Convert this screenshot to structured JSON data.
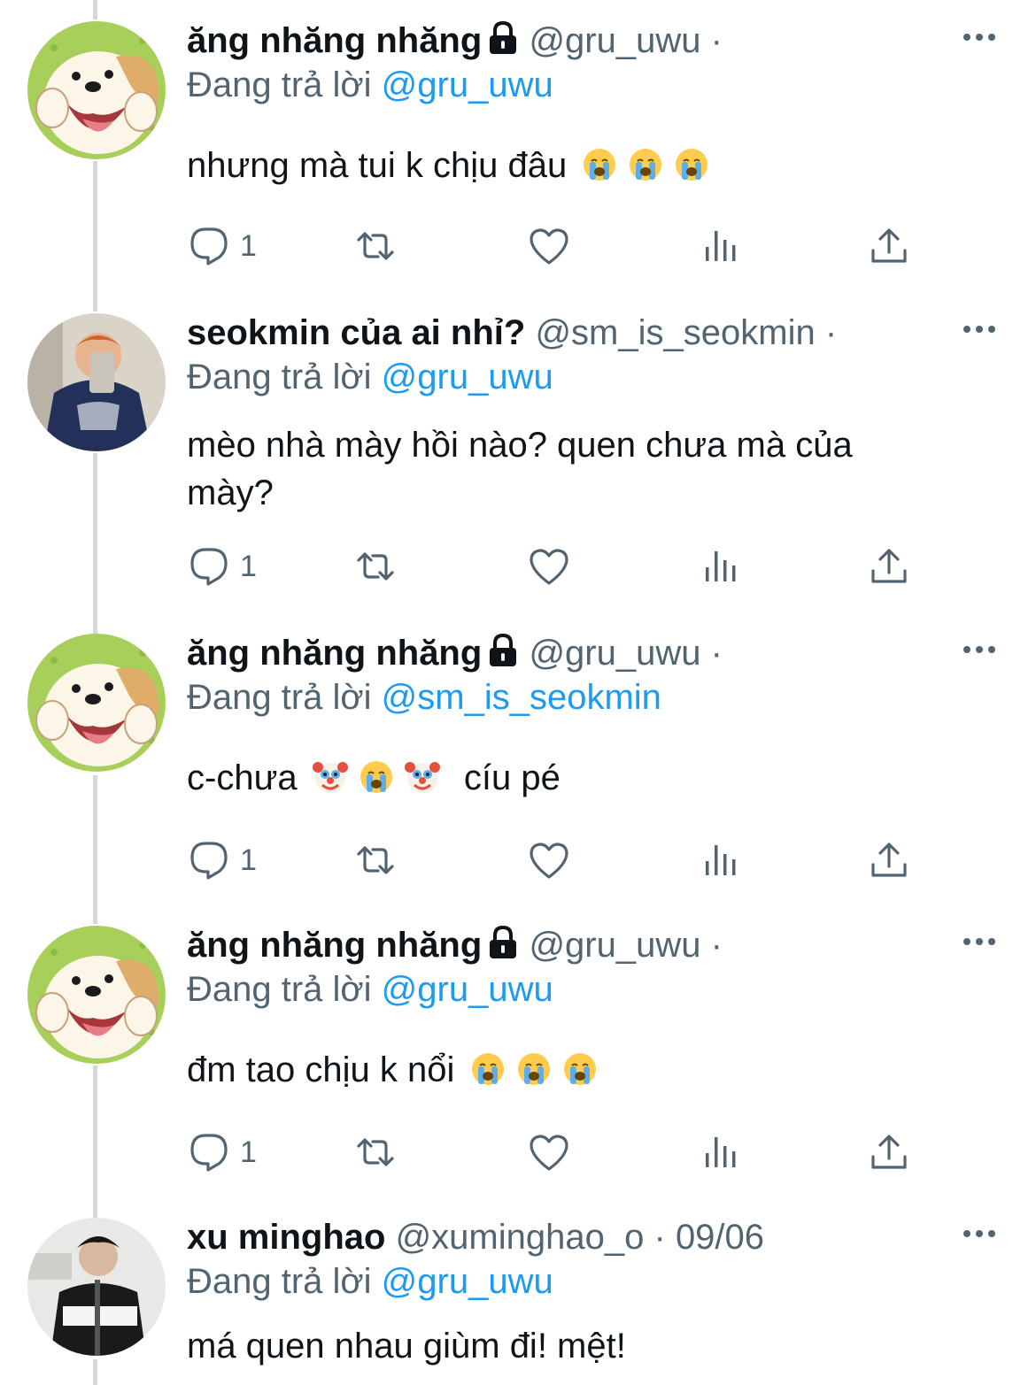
{
  "colors": {
    "text": "#0f1419",
    "muted": "#536471",
    "link": "#1d9bf0",
    "line": "#cfd9de"
  },
  "tweets": [
    {
      "avatar": "puppy-cartoon",
      "name": "ăng nhăng nhăng",
      "locked": true,
      "handle": "@gru_uwu",
      "sep": "·",
      "date": "",
      "replying_label": "Đang trả lời",
      "reply_to": "@gru_uwu",
      "text": "nhưng mà tui k chịu đâu",
      "emojis": [
        "crying-face-emoji",
        "crying-face-emoji",
        "crying-face-emoji"
      ],
      "suffix": "",
      "reply_count": "1"
    },
    {
      "avatar": "mirror-selfie-photo",
      "name": "seokmin của ai nhỉ?",
      "locked": false,
      "handle": "@sm_is_seokmin",
      "sep": "·",
      "date": "",
      "replying_label": "Đang trả lời",
      "reply_to": "@gru_uwu",
      "text_line1": "mèo nhà mày hồi nào? quen chưa mà của",
      "text_line2": "mày?",
      "reply_count": "1"
    },
    {
      "avatar": "puppy-cartoon",
      "name": "ăng nhăng nhăng",
      "locked": true,
      "handle": "@gru_uwu",
      "sep": "·",
      "date": "",
      "replying_label": "Đang trả lời",
      "reply_to": "@sm_is_seokmin",
      "text": "c-chưa",
      "emojis": [
        "clown-face-emoji",
        "crying-face-emoji",
        "clown-face-emoji"
      ],
      "suffix": "cíu pé",
      "reply_count": "1"
    },
    {
      "avatar": "puppy-cartoon",
      "name": "ăng nhăng nhăng",
      "locked": true,
      "handle": "@gru_uwu",
      "sep": "·",
      "date": "",
      "replying_label": "Đang trả lời",
      "reply_to": "@gru_uwu",
      "text": "đm tao chịu k nổi",
      "emojis": [
        "crying-face-emoji",
        "crying-face-emoji",
        "crying-face-emoji"
      ],
      "suffix": "",
      "reply_count": "1"
    },
    {
      "avatar": "jacket-portrait-photo",
      "name": "xu minghao",
      "locked": false,
      "handle": "@xuminghao_o",
      "sep": "·",
      "date": "09/06",
      "replying_label": "Đang trả lời",
      "reply_to": "@gru_uwu",
      "text": "má quen nhau giùm đi! mệt!",
      "emojis": [],
      "suffix": ""
    }
  ]
}
